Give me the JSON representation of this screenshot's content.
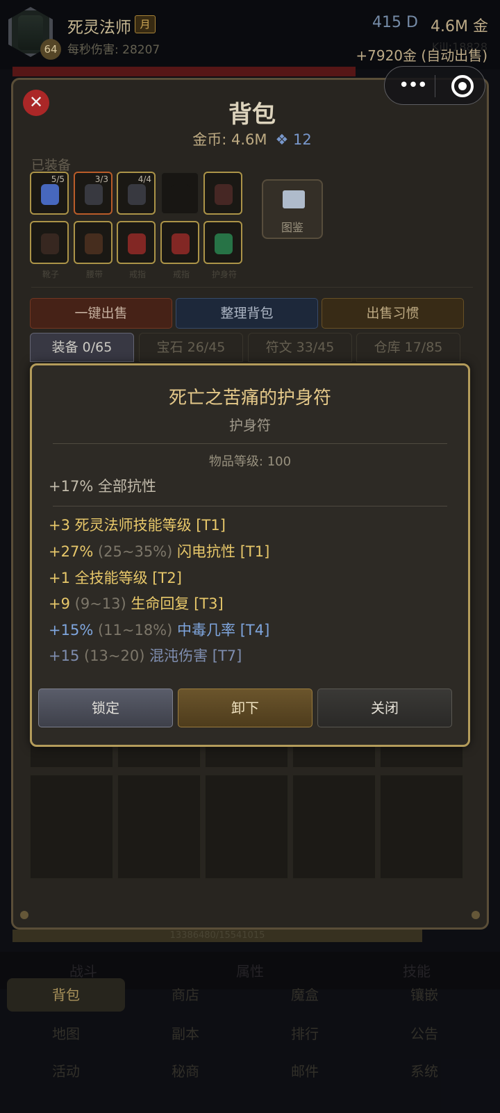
{
  "header": {
    "name": "死灵法师",
    "tag": "月",
    "level": "64",
    "dps": "每秒伤害: 28207",
    "diamonds": "415 D",
    "gold": "4.6M 金",
    "sell_msg": "+7920金 (自动出售)",
    "kill": "Kill:18828"
  },
  "bag": {
    "title": "背包",
    "gold": "金币: 4.6M",
    "diamond_count": "12",
    "equipped_label": "已装备",
    "codex": "图鉴",
    "slots_row1": [
      {
        "count": "5/5",
        "color": "#4b6ec9",
        "quality": "gold"
      },
      {
        "count": "3/3",
        "color": "#3b3d44",
        "quality": "red"
      },
      {
        "count": "4/4",
        "color": "#3b3d44",
        "quality": "gold"
      },
      {
        "count": "",
        "color": "#1a1815",
        "quality": "empty"
      },
      {
        "count": "",
        "color": "#4a2a26",
        "quality": "gold"
      }
    ],
    "slots_row2": [
      {
        "caption": "靴子",
        "color": "#3a2a22"
      },
      {
        "caption": "腰带",
        "color": "#4a3020"
      },
      {
        "caption": "戒指",
        "color": "#8a2a26"
      },
      {
        "caption": "戒指",
        "color": "#8a2a26"
      },
      {
        "caption": "护身符",
        "color": "#2a7a4a"
      }
    ],
    "actions": {
      "sell": "一键出售",
      "sort": "整理背包",
      "habit": "出售习惯"
    },
    "tabs": [
      "装备 0/65",
      "宝石 26/45",
      "符文 33/45",
      "仓库 17/85"
    ],
    "exp": "13386480/15541015"
  },
  "nav": {
    "top": [
      "战斗",
      "属性",
      "技能"
    ],
    "rows": [
      [
        "背包",
        "商店",
        "魔盒",
        "镶嵌"
      ],
      [
        "地图",
        "副本",
        "排行",
        "公告"
      ],
      [
        "活动",
        "秘商",
        "邮件",
        "系统"
      ]
    ]
  },
  "tooltip": {
    "title": "死亡之苦痛的护身符",
    "type": "护身符",
    "ilvl": "物品等级: 100",
    "implicit": "+17% 全部抗性",
    "affixes": [
      {
        "pre": "+3 死灵法师技能等级 [T1]",
        "range": "",
        "post": "",
        "color": "#e8c86a"
      },
      {
        "pre": "+27% ",
        "range": "(25~35%)",
        "post": " 闪电抗性 [T1]",
        "color": "#e8c86a"
      },
      {
        "pre": "+1 全技能等级 [T2]",
        "range": "",
        "post": "",
        "color": "#e8c86a"
      },
      {
        "pre": "+9 ",
        "range": "(9~13)",
        "post": " 生命回复 [T3]",
        "color": "#e8c86a"
      },
      {
        "pre": "+15% ",
        "range": "(11~18%)",
        "post": " 中毒几率 [T4]",
        "color": "#7fa6de"
      },
      {
        "pre": "+15 ",
        "range": "(13~20)",
        "post": " 混沌伤害 [T7]",
        "color": "#7f8eb0"
      }
    ],
    "buttons": {
      "lock": "锁定",
      "unequip": "卸下",
      "close": "关闭"
    }
  }
}
